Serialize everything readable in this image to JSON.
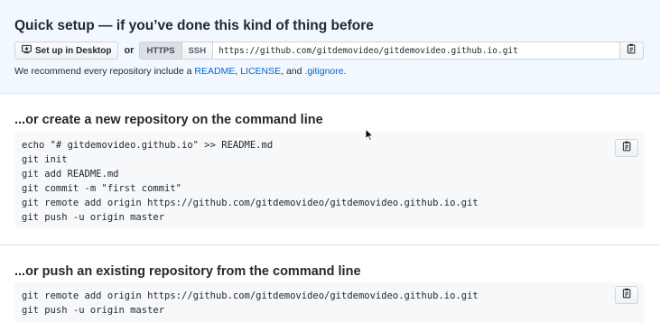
{
  "quick_setup": {
    "title": "Quick setup — if you’ve done this kind of thing before",
    "desktop_button": "Set up in Desktop",
    "or": "or",
    "https": "HTTPS",
    "ssh": "SSH",
    "url": "https://github.com/gitdemovideo/gitdemovideo.github.io.git",
    "recommend_prefix": "We recommend every repository include a ",
    "readme_link": "README",
    "sep1": ", ",
    "license_link": "LICENSE",
    "sep2": ", and ",
    "gitignore_link": ".gitignore",
    "recommend_suffix": "."
  },
  "create_section": {
    "title": "...or create a new repository on the command line",
    "lines": [
      "echo \"# gitdemovideo.github.io\" >> README.md",
      "git init",
      "git add README.md",
      "git commit -m \"first commit\"",
      "git remote add origin https://github.com/gitdemovideo/gitdemovideo.github.io.git",
      "git push -u origin master"
    ]
  },
  "push_section": {
    "title": "...or push an existing repository from the command line",
    "lines": [
      "git remote add origin https://github.com/gitdemovideo/gitdemovideo.github.io.git",
      "git push -u origin master"
    ]
  },
  "icons": {
    "desktop": "desktop-download-icon",
    "clipboard": "clipboard-icon",
    "cursor": "mouse-pointer-icon"
  }
}
